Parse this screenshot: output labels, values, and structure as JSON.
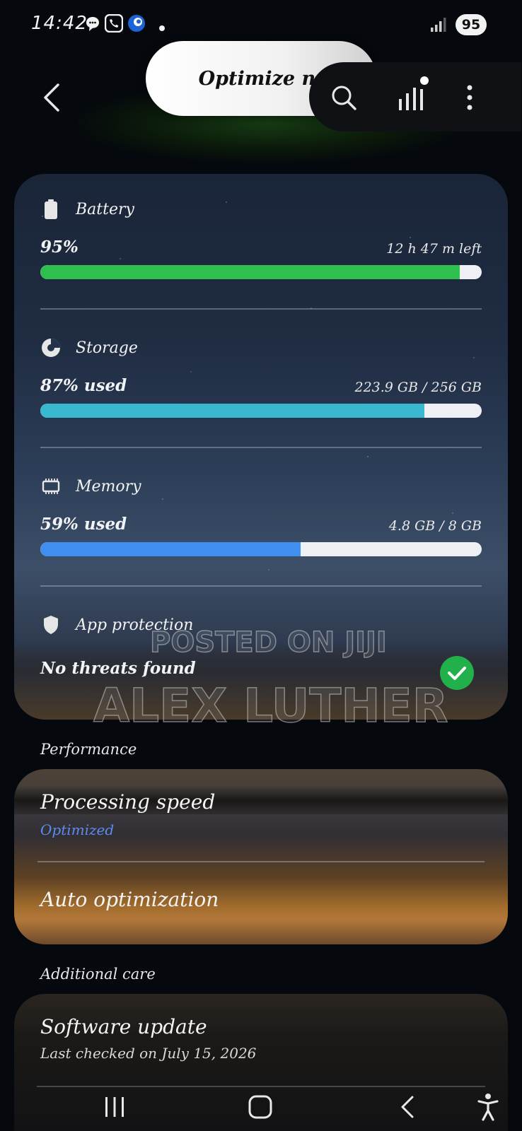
{
  "status_bar": {
    "time": "14:42",
    "battery_level": "95"
  },
  "top_bar": {
    "optimize_label": "Optimize now"
  },
  "device_care": {
    "battery": {
      "title": "Battery",
      "value": "95%",
      "detail": "12 h 47 m left",
      "fill": 0.95,
      "color": "#2fbf4f"
    },
    "storage": {
      "title": "Storage",
      "value": "87% used",
      "detail": "223.9 GB / 256 GB",
      "fill": 0.87,
      "color": "#3ab8d0"
    },
    "memory": {
      "title": "Memory",
      "value": "59% used",
      "detail": "4.8 GB / 8 GB",
      "fill": 0.59,
      "color": "#3f8ef0"
    },
    "app_protection": {
      "title": "App protection",
      "status": "No threats found",
      "check_color": "#22b04b"
    }
  },
  "performance": {
    "heading": "Performance",
    "items": [
      {
        "title": "Processing speed",
        "subtitle": "Optimized",
        "subtitle_color": "#5b8cf0"
      },
      {
        "title": "Auto optimization"
      }
    ]
  },
  "additional_care": {
    "heading": "Additional care",
    "items": [
      {
        "title": "Software update",
        "subtitle": "Last checked on July 15, 2026"
      }
    ]
  },
  "watermark": {
    "line1": "POSTED ON JIJI",
    "line2": "ALEX LUTHER"
  },
  "icons": [
    "back-arrow-icon",
    "search-icon",
    "signal-stats-icon",
    "more-options-icon",
    "battery-icon",
    "storage-pie-icon",
    "memory-chip-icon",
    "shield-icon",
    "check-icon",
    "recent-apps-icon",
    "home-icon",
    "nav-back-icon",
    "accessibility-icon"
  ]
}
